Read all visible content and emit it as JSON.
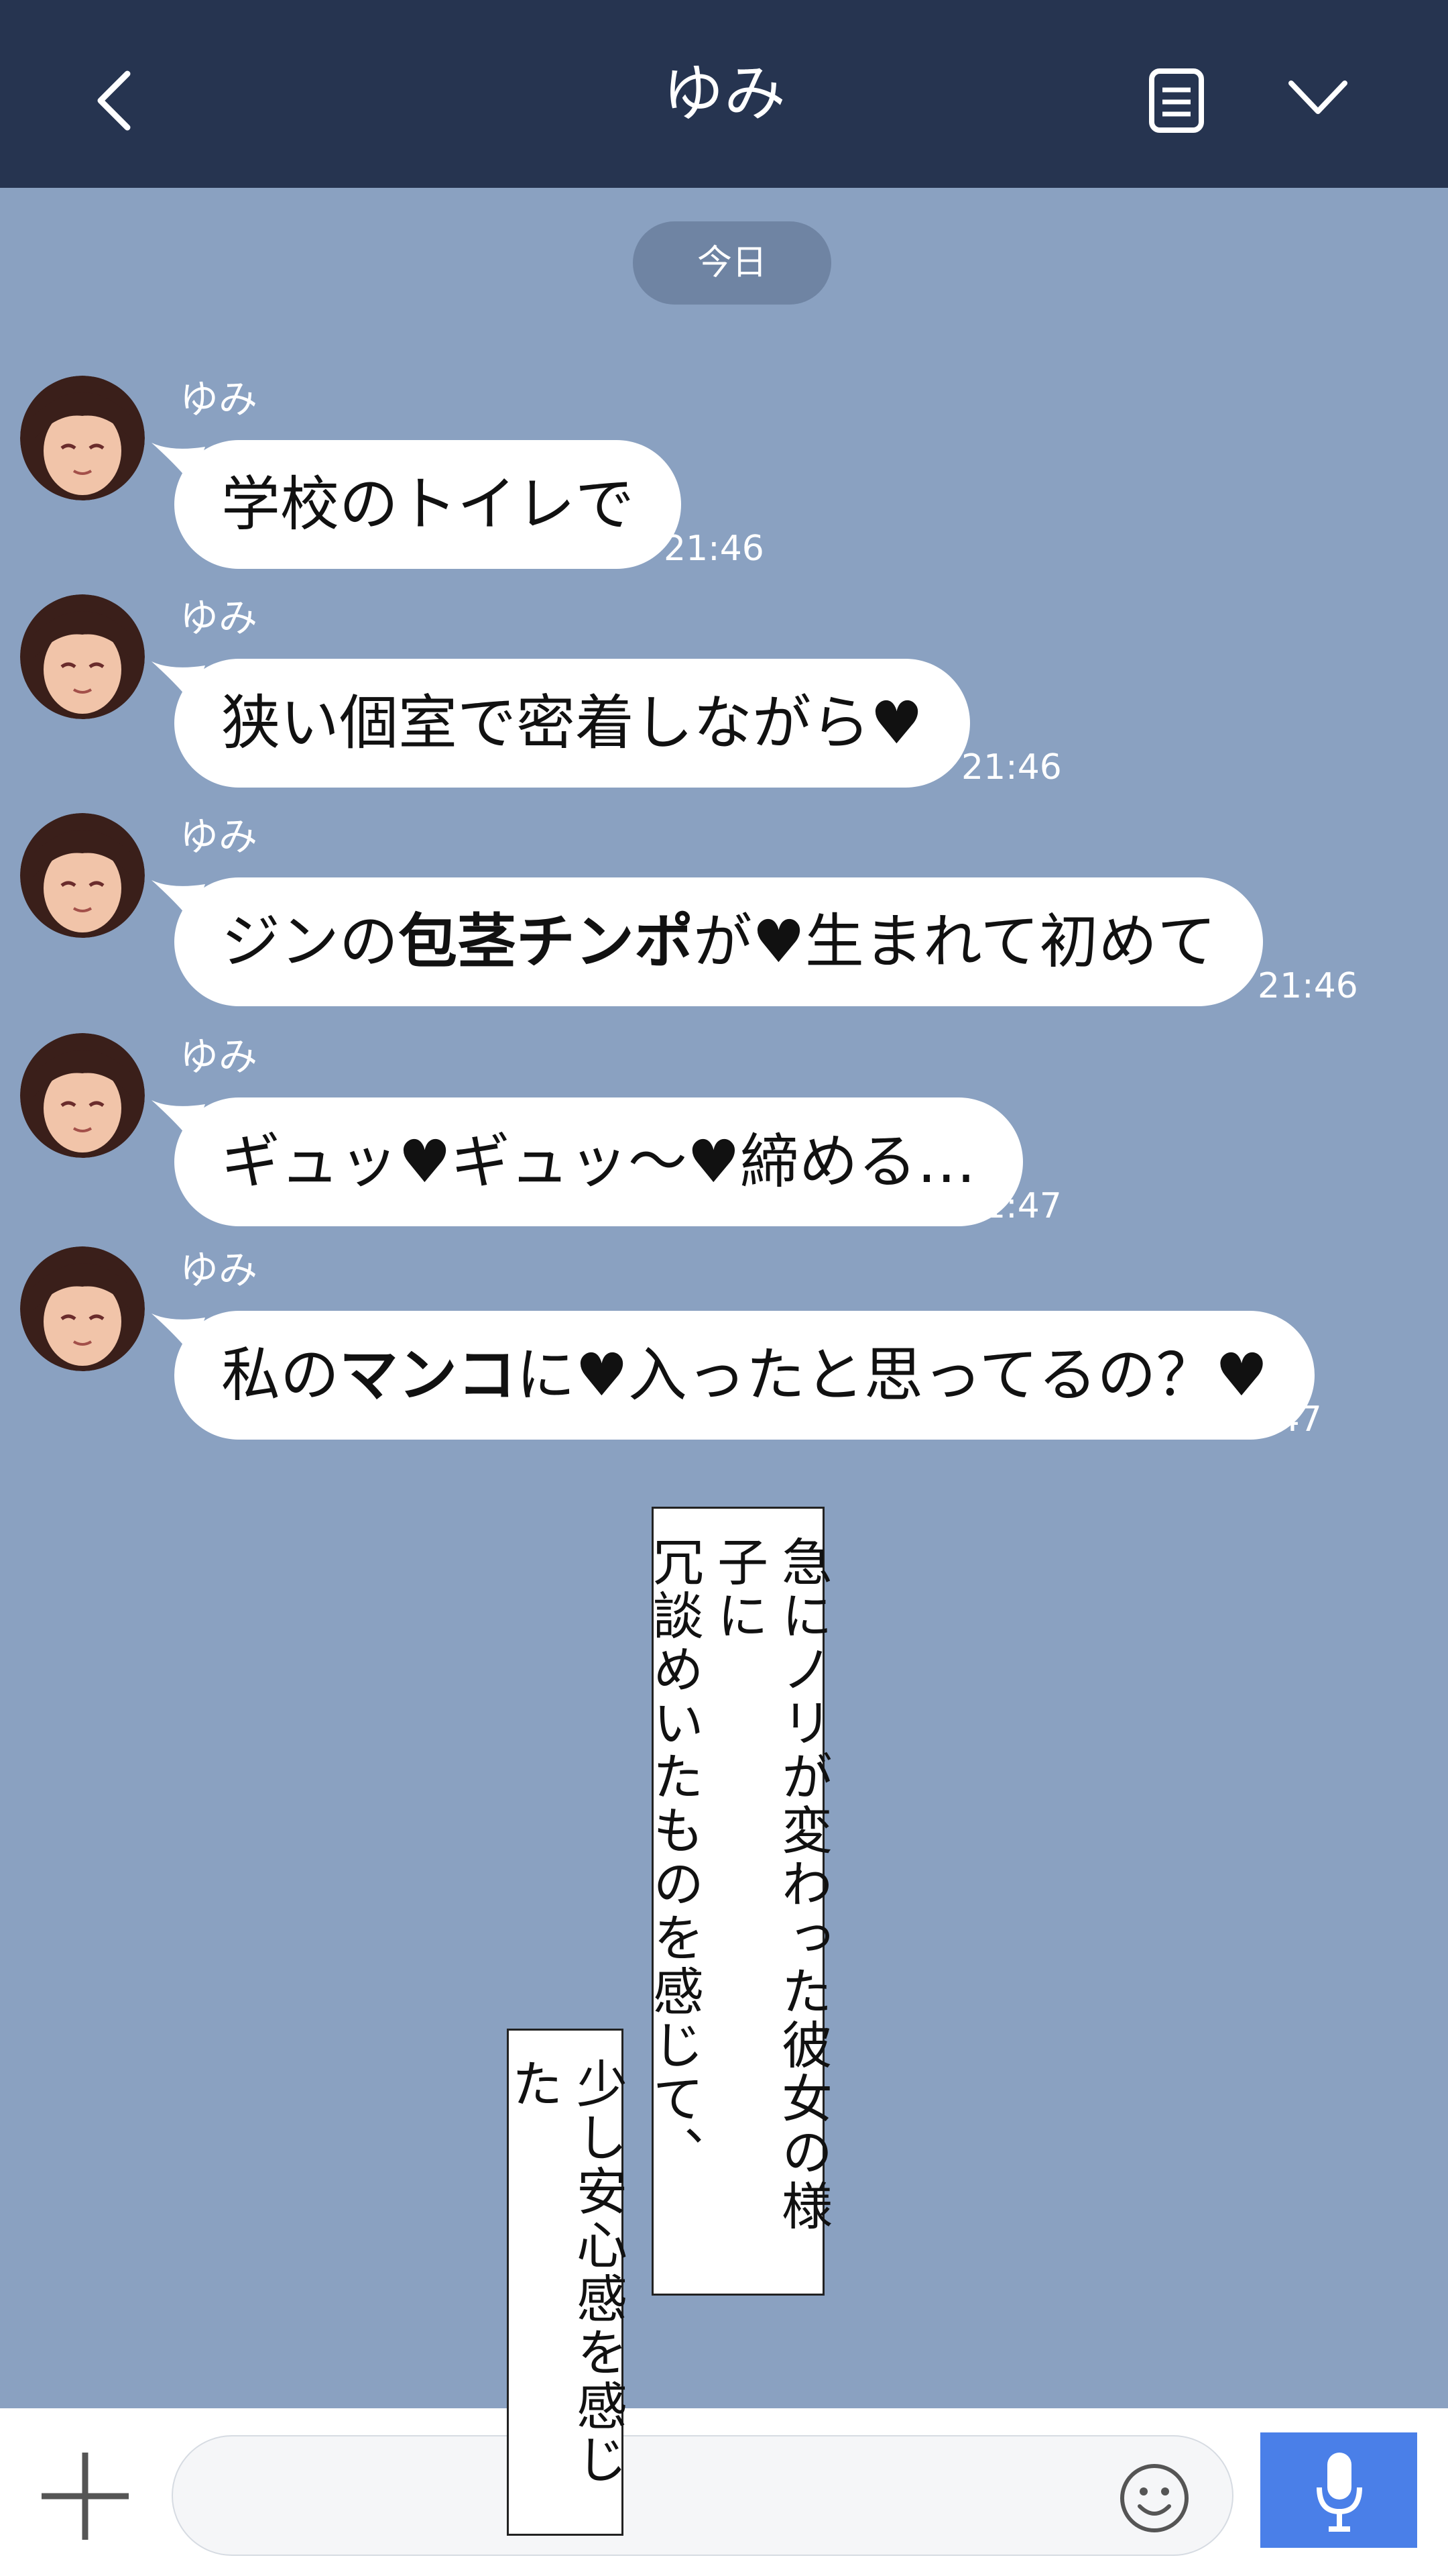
{
  "header": {
    "title": "ゆみ",
    "back_icon": "chevron-left-icon",
    "notes_icon": "document-icon",
    "expand_icon": "chevron-down-icon"
  },
  "date_divider": "今日",
  "messages": [
    {
      "sender": "ゆみ",
      "parts": [
        {
          "t": "学校のトイレで"
        }
      ],
      "time": "21:46"
    },
    {
      "sender": "ゆみ",
      "parts": [
        {
          "t": "狭い個室で密着しながら♥"
        }
      ],
      "time": "21:46"
    },
    {
      "sender": "ゆみ",
      "parts": [
        {
          "t": "ジンの"
        },
        {
          "t": "包茎チンポ",
          "b": true
        },
        {
          "t": "が♥生まれて初めて"
        }
      ],
      "time": "21:46"
    },
    {
      "sender": "ゆみ",
      "parts": [
        {
          "t": "ギュッ♥ギュッ～♥締める…"
        }
      ],
      "time": "21:47"
    },
    {
      "sender": "ゆみ",
      "parts": [
        {
          "t": "私の"
        },
        {
          "t": "マンコ",
          "b": true
        },
        {
          "t": "に♥入ったと思ってるの？♥"
        }
      ],
      "time": "21:47"
    }
  ],
  "narration": {
    "box1": [
      "急にノリが変わった彼女の様子に",
      "冗談めいたものを感じて、"
    ],
    "box2": [
      "少し安心感を感じた"
    ]
  },
  "footer": {
    "input_placeholder": "",
    "add_icon": "plus-icon",
    "emoji_icon": "smiley-icon",
    "mic_icon": "microphone-icon"
  },
  "colors": {
    "header": "#263450",
    "chat_bg": "#8aa1c1",
    "mic": "#4a7fe8"
  }
}
